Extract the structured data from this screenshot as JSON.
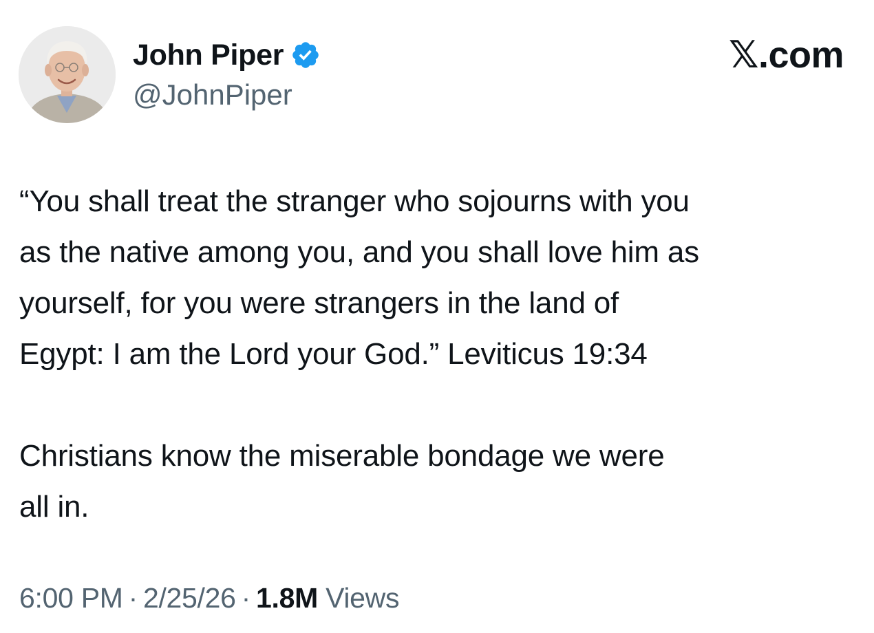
{
  "author": {
    "display_name": "John Piper",
    "handle": "@JohnPiper",
    "avatar_icon": "person-portrait-avatar",
    "verified_icon": "verified-badge-icon",
    "verified_color": "#1d9bf0"
  },
  "brand": {
    "label": "𝕏.com"
  },
  "tweet": {
    "paragraphs": [
      "“You shall treat the stranger who sojourns with you\nas the native among you, and you shall love him as\nyourself, for you were strangers in the land of\nEgypt: I am the Lord your God.” Leviticus 19:34",
      "Christians know the miserable bondage we were\nall in."
    ]
  },
  "meta": {
    "time": "6:00 PM",
    "date": "2/25/26",
    "separator": "·",
    "views_count": "1.8M",
    "views_label": "Views"
  },
  "colors": {
    "text_primary": "#0f1419",
    "text_secondary": "#536471",
    "background": "#ffffff"
  }
}
